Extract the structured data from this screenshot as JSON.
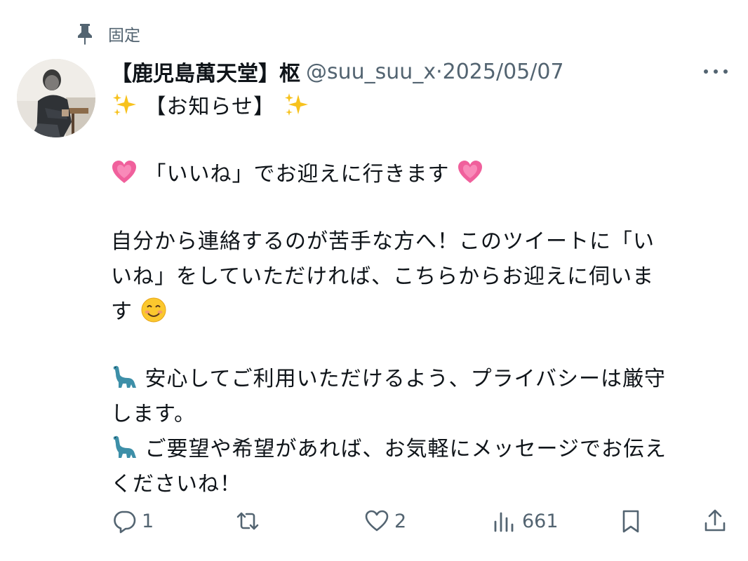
{
  "pinned": {
    "label": "固定"
  },
  "author": {
    "name": "【鹿児島萬天堂】枢",
    "handle": "@suu_suu_x",
    "separator": "·",
    "date": "2025/05/07"
  },
  "post": {
    "line1": "【お知らせ】",
    "line2": "「いいね」でお迎えに行きます",
    "line3": "自分から連絡するのが苦手な方へ！このツイートに「い",
    "line4": "いね」をしていただければ、こちらからお迎えに伺いま",
    "line5": "す",
    "line6": "安心してご利用いただけるよう、プライバシーは厳守",
    "line7": "します。",
    "line8": "ご要望や希望があれば、お気軽にメッセージでお伝え",
    "line9": "くださいね！"
  },
  "actions": {
    "reply_count": "1",
    "repost_count": "",
    "like_count": "2",
    "view_count": "661"
  },
  "icons": {
    "pin": "pin-icon",
    "more": "more-icon",
    "sparkles": "sparkles-emoji",
    "heart": "growing-heart-emoji",
    "smile": "smiling-face-emoji",
    "dino": "sauropod-emoji",
    "reply": "reply-icon",
    "repost": "repost-icon",
    "like": "like-icon",
    "views": "views-icon",
    "bookmark": "bookmark-icon",
    "share": "share-icon"
  },
  "colors": {
    "text": "#0f1419",
    "secondary": "#536471",
    "heart_pink": "#f0609c",
    "dino_teal": "#3d8fa8"
  }
}
